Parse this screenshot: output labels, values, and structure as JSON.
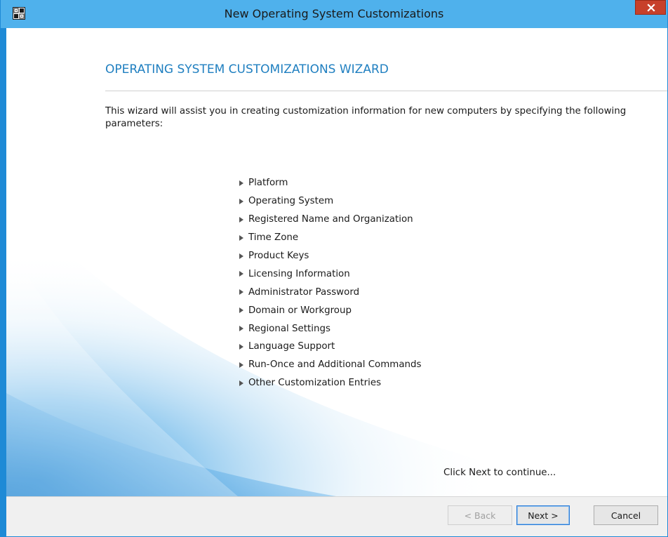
{
  "window": {
    "title": "New Operating System Customizations"
  },
  "wizard": {
    "heading": "OPERATING SYSTEM CUSTOMIZATIONS WIZARD",
    "intro": "This wizard will assist you in creating customization information for new computers by specifying the following parameters:",
    "parameters": [
      "Platform",
      "Operating System",
      "Registered Name and Organization",
      "Time Zone",
      "Product Keys",
      "Licensing Information",
      "Administrator Password",
      "Domain or Workgroup",
      "Regional Settings",
      "Language Support",
      "Run-Once and Additional Commands",
      "Other Customization Entries"
    ],
    "continue_text": "Click Next to continue..."
  },
  "footer": {
    "back_label": "< Back",
    "next_label": "Next >",
    "cancel_label": "Cancel",
    "back_enabled": false
  },
  "colors": {
    "titlebar": "#4fb1ec",
    "heading": "#1f7fc0",
    "close_button": "#c7402a"
  },
  "icons": {
    "app": "wizard-app-icon",
    "close": "close-icon",
    "bullet": "triangle-right-icon"
  }
}
